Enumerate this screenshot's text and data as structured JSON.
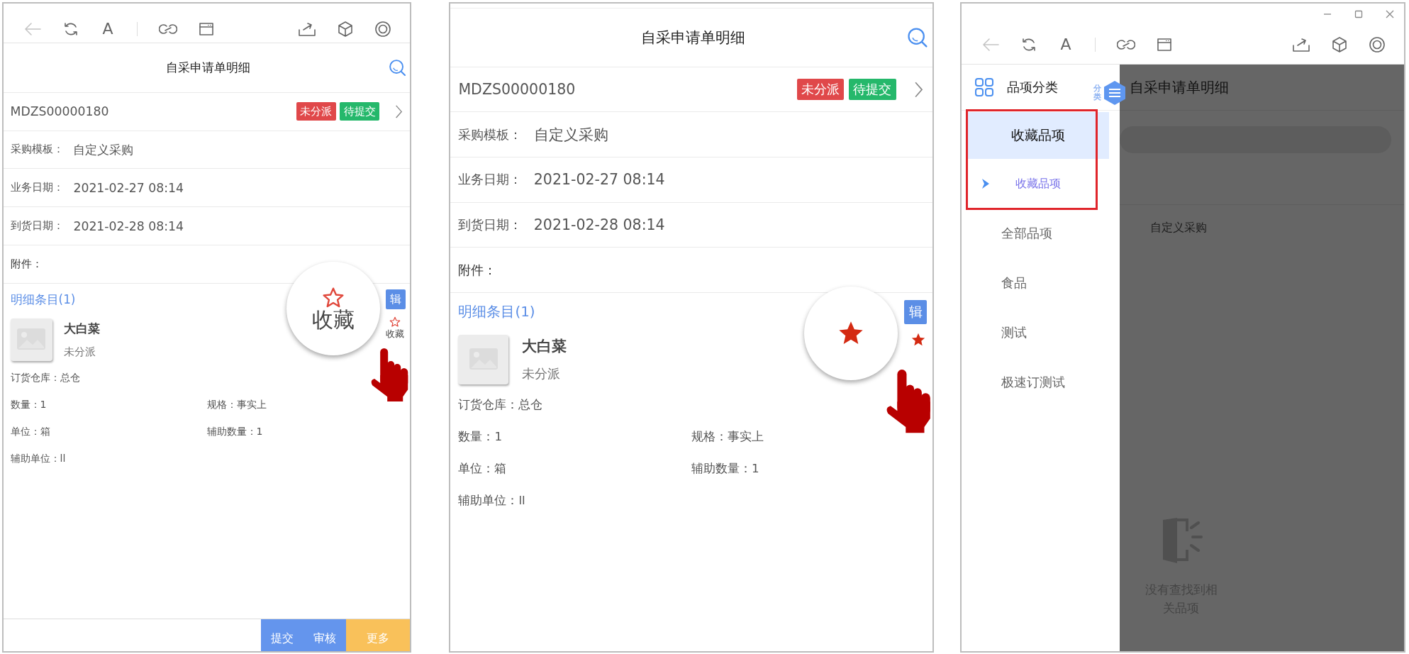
{
  "panels": [
    {
      "kind": "detail",
      "toolbar": {
        "font_label": "A"
      },
      "title": "自采申请单明细",
      "order_no": "MDZS00000180",
      "tags": [
        {
          "label": "未分派",
          "color": "#e0484a"
        },
        {
          "label": "待提交",
          "color": "#25b86b"
        }
      ],
      "fields": [
        {
          "label": "采购模板：",
          "value": "自定义采购"
        },
        {
          "label": "业务日期：",
          "value": "2021-02-27 08:14"
        },
        {
          "label": "到货日期：",
          "value": "2021-02-28 08:14"
        },
        {
          "label": "附件："
        }
      ],
      "section_title": "明细条目(1)",
      "edit_button": "辑",
      "item": {
        "name": "大白菜",
        "status": "未分派",
        "lines": [
          "订货仓库：总仓",
          "数量：1",
          "规格：事实上",
          "单位：箱",
          "辅助数量：1",
          "辅助单位：ll"
        ]
      },
      "magnifier": {
        "label": "收藏",
        "starred": false
      },
      "favorite": {
        "label": "收藏",
        "starred": false
      },
      "footer_buttons": [
        {
          "label": "提交",
          "color": "#6495ed"
        },
        {
          "label": "审核",
          "color": "#6495ed"
        },
        {
          "label": "更多",
          "color": "#f9c15a"
        }
      ]
    },
    {
      "kind": "detail",
      "title": "自采申请单明细",
      "order_no": "MDZS00000180",
      "tags": [
        {
          "label": "未分派",
          "color": "#e0484a"
        },
        {
          "label": "待提交",
          "color": "#25b86b"
        }
      ],
      "fields": [
        {
          "label": "采购模板：",
          "value": "自定义采购"
        },
        {
          "label": "业务日期：",
          "value": "2021-02-27 08:14"
        },
        {
          "label": "到货日期：",
          "value": "2021-02-28 08:14"
        },
        {
          "label": "附件："
        }
      ],
      "section_title": "明细条目(1)",
      "edit_button": "辑",
      "item": {
        "name": "大白菜",
        "status": "未分派",
        "lines": [
          "订货仓库：总仓",
          "数量：1",
          "规格：事实上",
          "单位：箱",
          "辅助数量：1",
          "辅助单位：ll"
        ]
      },
      "magnifier": {
        "starred": true
      },
      "favorite": {
        "starred": true
      }
    },
    {
      "kind": "category",
      "window_controls": true,
      "toolbar": {
        "font_label": "A"
      },
      "header": "品项分类",
      "badge": "分类",
      "overlay_title": "自采申请单明细",
      "overlay_value": "自定义采购",
      "categories": [
        {
          "label": "收藏品项",
          "selected": true,
          "highlighted": true,
          "children": [
            {
              "label": "收藏品项",
              "selected": true
            }
          ]
        },
        {
          "label": "全部品项",
          "selected": false,
          "highlighted": false
        },
        {
          "label": "食品",
          "selected": false,
          "highlighted": false
        },
        {
          "label": "测试",
          "selected": false,
          "highlighted": false
        },
        {
          "label": "极速订测试",
          "selected": false,
          "highlighted": false
        }
      ],
      "empty_text": "没有查找到相关品项"
    }
  ]
}
